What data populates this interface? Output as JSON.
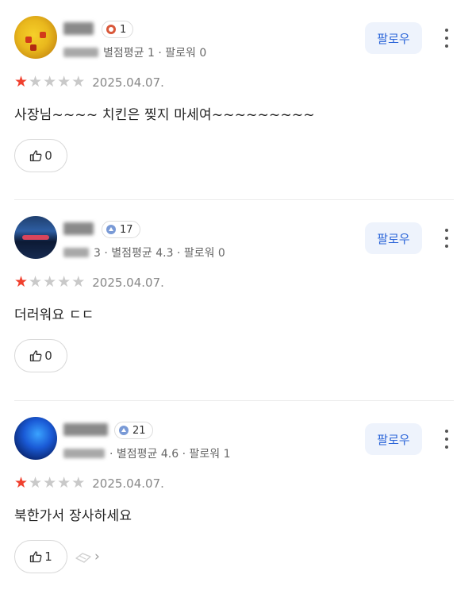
{
  "reviews": [
    {
      "level": "1",
      "meta": "별점평균 1 · 팔로워 0",
      "follow_label": "팔로우",
      "rating": 1,
      "date": "2025.04.07.",
      "text": "사장님~~~~ 치킨은 찢지 마세여~~~~~~~~~",
      "likes": "0"
    },
    {
      "level": "17",
      "meta": "3 · 별점평균 4.3 · 팔로워 0",
      "follow_label": "팔로우",
      "rating": 1,
      "date": "2025.04.07.",
      "text": "더러워요 ㄷㄷ",
      "likes": "0"
    },
    {
      "level": "21",
      "meta": "· 별점평균 4.6 · 팔로워 1",
      "follow_label": "팔로우",
      "rating": 1,
      "date": "2025.04.07.",
      "text": "북한가서 장사하세요",
      "likes": "1"
    }
  ],
  "icons": {
    "star": "star-icon",
    "thumb": "thumbs-up-icon",
    "more": "more-vertical-icon",
    "level_low": "level-badge-red-icon",
    "level_high": "level-badge-blue-icon"
  },
  "colors": {
    "star_filled": "#f0402e",
    "star_empty": "#c9c9c9",
    "follow_text": "#2a64d8",
    "follow_bg": "#eef3fc"
  }
}
